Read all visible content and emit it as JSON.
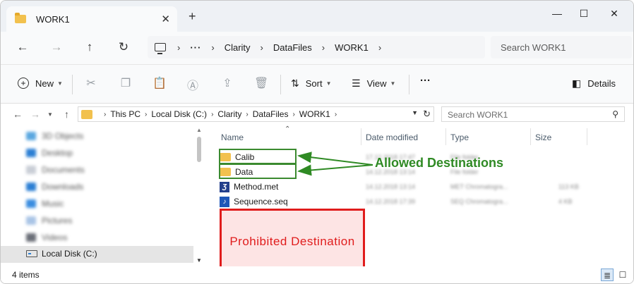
{
  "tab": {
    "title": "WORK1",
    "close": "✕",
    "add": "+"
  },
  "window_controls": {
    "minimize": "—",
    "maximize": "☐",
    "close": "✕"
  },
  "addressbar": {
    "more": "···",
    "crumbs": [
      "Clarity",
      "DataFiles",
      "WORK1"
    ],
    "search_placeholder": "Search WORK1"
  },
  "commandbar": {
    "new_label": "New",
    "sort_label": "Sort",
    "view_label": "View",
    "more": "···",
    "details_label": "Details"
  },
  "classic_address": {
    "crumbs": [
      "This PC",
      "Local Disk (C:)",
      "Clarity",
      "DataFiles",
      "WORK1"
    ],
    "search_placeholder": "Search WORK1"
  },
  "navpane": {
    "items": [
      "3D Objects",
      "Desktop",
      "Documents",
      "Downloads",
      "Music",
      "Pictures",
      "Videos"
    ],
    "selected": "Local Disk (C:)"
  },
  "columns": {
    "name": "Name",
    "date": "Date modified",
    "type": "Type",
    "size": "Size"
  },
  "files": [
    {
      "name": "Calib",
      "kind": "folder",
      "date": "17.12.2018 17:47",
      "type": "File folder",
      "size": ""
    },
    {
      "name": "Data",
      "kind": "folder",
      "date": "14.12.2018 13:14",
      "type": "File folder",
      "size": ""
    },
    {
      "name": "Method.met",
      "kind": "met",
      "date": "14.12.2018 13:14",
      "type": "MET Chromatogra...",
      "size": "113 KB"
    },
    {
      "name": "Sequence.seq",
      "kind": "seq",
      "date": "14.12.2018 17:39",
      "type": "SEQ Chromatogra...",
      "size": "4 KB"
    }
  ],
  "annotations": {
    "allowed": "Allowed Destinations",
    "prohibited": "Prohibited  Destination",
    "allowed_color": "#2f8a24",
    "prohibited_color": "#e01c1c"
  },
  "status": {
    "items": "4 items"
  }
}
